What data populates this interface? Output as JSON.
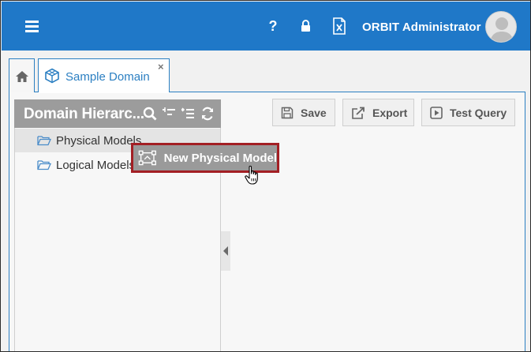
{
  "header": {
    "menu_icon": "hamburger-menu-icon",
    "help_icon": "question-mark-icon",
    "lock_icon": "lock-icon",
    "export_icon": "excel-file-icon",
    "user_name": "ORBIT Administrator",
    "avatar_icon": "user-avatar-icon",
    "color": "#1f78c8"
  },
  "tabs": [
    {
      "icon": "home-icon",
      "label": ""
    },
    {
      "icon": "cube-icon",
      "label": "Sample Domain",
      "close": "×"
    }
  ],
  "hierarchy": {
    "title": "Domain Hierarc...",
    "tools": [
      "search-icon",
      "collapse-icon",
      "expand-icon",
      "refresh-icon"
    ],
    "items": [
      {
        "label": "Physical Models",
        "icon": "folder-open-icon",
        "selected": true
      },
      {
        "label": "Logical Models",
        "icon": "folder-open-icon",
        "selected": false
      }
    ]
  },
  "toolbar": {
    "save_label": "Save",
    "export_label": "Export",
    "test_query_label": "Test Query"
  },
  "context_menu": {
    "item_label": "New Physical Model",
    "item_icon": "physical-model-icon",
    "highlight_color": "#a31f24"
  }
}
